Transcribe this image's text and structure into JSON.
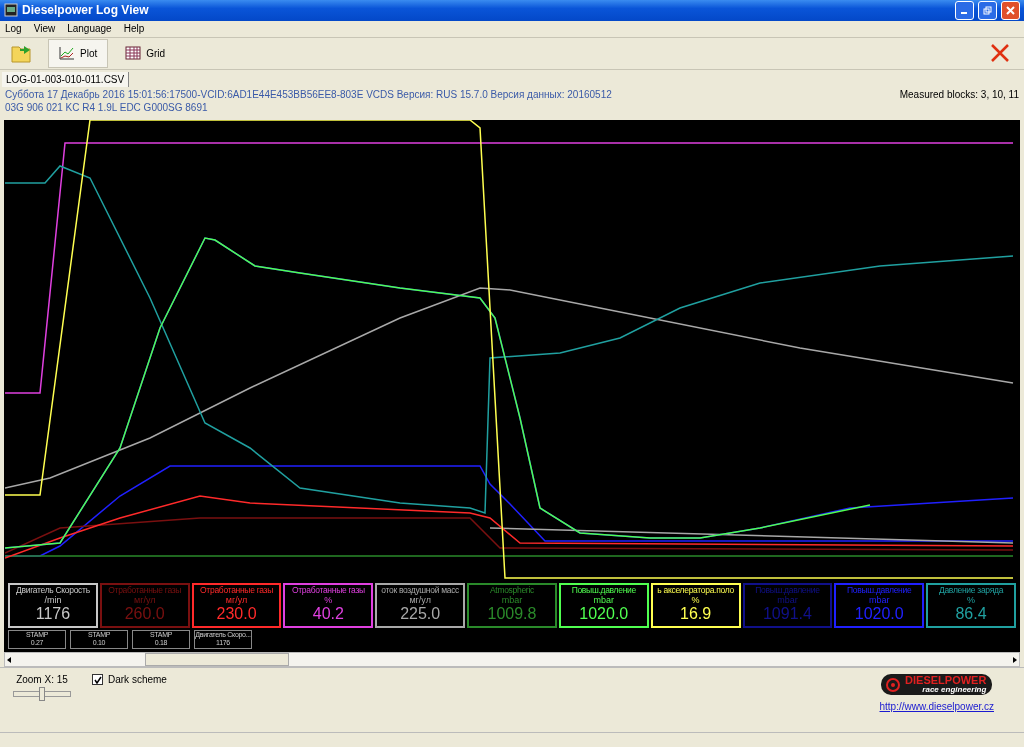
{
  "window": {
    "title": "Dieselpower Log View"
  },
  "menu": [
    "Log",
    "View",
    "Language",
    "Help"
  ],
  "toolbar": [
    {
      "label": "Plot",
      "selected": true
    },
    {
      "label": "Grid",
      "selected": false
    }
  ],
  "file_tab": {
    "label": "LOG-01-003-010-011.CSV"
  },
  "info": {
    "line_1": "Суббота 17 Декабрь 2016 15:01:56:17500-VCID:6AD1E44E453BB56EE8-803E VCDS Версия: RUS 15.7.0 Версия данных: 20160512",
    "line_2": "03G 906 021 KC  R4 1.9L EDC G000SG  8691",
    "measured_blocks": "Measured blocks: 3, 10, 11"
  },
  "gauges": [
    {
      "name": "Двигатель Скорость",
      "unit": "/min",
      "value": "1176",
      "color": "#c8c8c8"
    },
    {
      "name": "Отработанные газы",
      "unit": "мг/ул",
      "value": "260.0",
      "color": "#7a1010"
    },
    {
      "name": "Отработанные газы",
      "unit": "мг/ул",
      "value": "230.0",
      "color": "#ff2a2a"
    },
    {
      "name": "Отработанные газы",
      "unit": "%",
      "value": "40.2",
      "color": "#e040e0"
    },
    {
      "name": "оток воздушной масс",
      "unit": "мг/ул",
      "value": "225.0",
      "color": "#a8a8a8"
    },
    {
      "name": "Atmospheric",
      "unit": "mbar",
      "value": "1009.8",
      "color": "#2a8a2a"
    },
    {
      "name": "Повыш.давление",
      "unit": "mbar",
      "value": "1020.0",
      "color": "#50ff50"
    },
    {
      "name": "ь акселератора.поло",
      "unit": "%",
      "value": "16.9",
      "color": "#ffff50"
    },
    {
      "name": "Повыш.давление",
      "unit": "mbar",
      "value": "1091.4",
      "color": "#10108a"
    },
    {
      "name": "Повыш.давление",
      "unit": "mbar",
      "value": "1020.0",
      "color": "#2020ff"
    },
    {
      "name": "Давление заряда",
      "unit": "%",
      "value": "86.4",
      "color": "#20a0a0"
    }
  ],
  "stamps": [
    {
      "name": "STAMP",
      "value": "0.27"
    },
    {
      "name": "STAMP",
      "value": "0.10"
    },
    {
      "name": "STAMP",
      "value": "0.18"
    },
    {
      "name": "Двигатель Скоро...",
      "value": "1176"
    }
  ],
  "zoom": {
    "label": "Zoom X: 15",
    "level": 0.5
  },
  "dark_scheme": {
    "label": "Dark scheme",
    "checked": true
  },
  "logo": {
    "name": "DIESELPOWER",
    "tagline": "race engineering"
  },
  "link": "http://www.dieselpower.cz"
}
